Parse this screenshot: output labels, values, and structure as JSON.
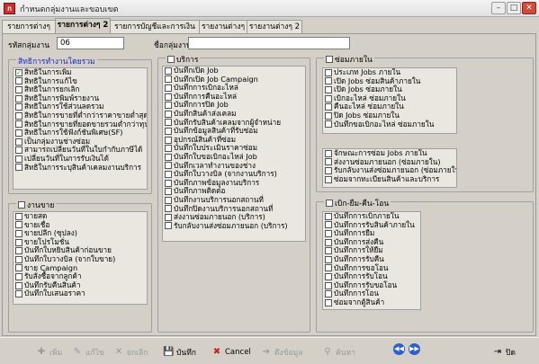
{
  "window": {
    "title": "กำหนดกลุ่มงานและขอบเขต"
  },
  "tabs": [
    "รายการต่างๆ",
    "รายการต่างๆ 2",
    "รายการบัญชีและการเงิน",
    "รายงานต่างๆ",
    "รายงานต่างๆ 2"
  ],
  "active_tab": "รายการต่างๆ 2",
  "form": {
    "group_code_label": "รหัสกลุ่มงาน",
    "group_code_value": "06",
    "group_name_label": "ชื่อกลุ่มงาน",
    "group_name_value": ""
  },
  "rights": {
    "title": "สิทธิการทำงานโดยรวม",
    "items": [
      {
        "label": "สิทธิในการเพิ่ม",
        "checked": true
      },
      {
        "label": "สิทธิในการแก้ไข",
        "checked": false
      },
      {
        "label": "สิทธิในการยกเลิก",
        "checked": false
      },
      {
        "label": "สิทธิในการพิมพ์รายงาน",
        "checked": false
      },
      {
        "label": "สิทธิในการใช้ส่วนลดรวม",
        "checked": false
      },
      {
        "label": "สิทธิในการขายที่ต่ำกว่าราคาขายต่ำสุด",
        "checked": false
      },
      {
        "label": "สิทธิในการขายที่ยอดขายรวมต่ำกว่าทุน",
        "checked": false
      },
      {
        "label": "สิทธิในการใช้ฟังก์ชันพิเศษ(SF)",
        "checked": false
      },
      {
        "label": "เป็นกลุ่มงานช่างซ่อม",
        "checked": false
      },
      {
        "label": "สามารถเปลี่ยนวันที่ในใบกำกับภาษีได้",
        "checked": false
      },
      {
        "label": "เปลี่ยนวันที่ในการรับเงินได้",
        "checked": false
      },
      {
        "label": "สิทธิในการระบุสินค้าเคลมงานบริการ",
        "checked": false
      }
    ]
  },
  "sales": {
    "title": "งานขาย",
    "items": [
      "ขายสด",
      "ขายเชื่อ",
      "ขายปลีก (ซุปลง)",
      "ขายโปรโมชั่น",
      "บันทึกใบหยิบสินค้าก่อนขาย",
      "บันทึกใบวางบิล (จากใบขาย)",
      "ขาย Campaign",
      "รับสั่งซื้อจากลูกค้า",
      "บันทึกรับคืนสินค้า",
      "บันทึกใบเสนอราคา"
    ]
  },
  "service": {
    "title": "บริการ",
    "items": [
      "บันทึกเปิด Job",
      "บันทึกเปิด Job Campaign",
      "บันทึกการเบิกอะไหล่",
      "บันทึกการคืนอะไหล่",
      "บันทึกการปิด Job",
      "บันทึกสินค้าส่งเคลม",
      "บันทึกรับสินค้าเคลมจากผู้จำหน่าย",
      "บันทึกข้อมูลสินค้าที่รับซ่อม",
      "อุปกรณ์สินค้าที่ซ่อม",
      "บันทึกใบประเมินราคาซ่อม",
      "บันทึกใบขอเบิกอะไหล่ Job",
      "บันทึกเวลาทำงานของช่าง",
      "บันทึกใบวางบิล (จากงานบริการ)",
      "บันทึกภาพข้อมูลงานบริการ",
      "บันทึกภาพติดต่อ",
      "บันทึกงานบริการนอกสถานที่",
      "บันทึกปิดงานบริการนอกสถานที่",
      "ส่งงานซ่อมภายนอก (บริการ)",
      "รับกลับงานส่งซ่อมภายนอก (บริการ)"
    ]
  },
  "internal_repair": {
    "title": "ซ่อมภายใน",
    "items1": [
      "ประเภท Jobs ภายใน",
      "เปิด Jobs ซ่อมสินค้าภายใน",
      "เปิด Jobs ซ่อมภายใน",
      "เบิกอะไหล่ ซ่อมภายใน",
      "คืนอะไหล่ ซ่อมภายใน",
      "ปิด Jobs ซ่อมภายใน",
      "บันทึกขอเบิกอะไหล่ ซ่อมภายใน"
    ],
    "items2": [
      "จักษณะการซ่อม Jobs ภายใน",
      "ส่งงานซ่อมภายนอก (ซ่อมภายใน)",
      "รับกลับงานส่งซ่อมภายนอก (ซ่อมภายใน)",
      "ซ่อมจากทะเบียนสินค้าและบริการ"
    ]
  },
  "withdraw": {
    "title": "เบิก-ยืม-คืน-โอน",
    "items": [
      "บันทึกการเบิกภายใน",
      "บันทึกการรับสินค้าภายใน",
      "บันทึกการยืม",
      "บันทึกการส่งคืน",
      "บันทึกการให้ยืม",
      "บันทึกการรับคืน",
      "บันทึกการขอโอน",
      "บันทึกการรับโอน",
      "บันทึกการรับขอโอน",
      "บันทึกการโอน",
      "ซ่อมจากตู้สินค้า"
    ]
  },
  "toolbar": {
    "add": "เพิ่ม",
    "edit": "แก้ไข",
    "cancel_doc": "ยกเลิก",
    "save": "บันทึก",
    "cancel": "Cancel",
    "fetch": "ดึงข้อมูล",
    "search": "ค้นหา",
    "close": "ปิด"
  }
}
